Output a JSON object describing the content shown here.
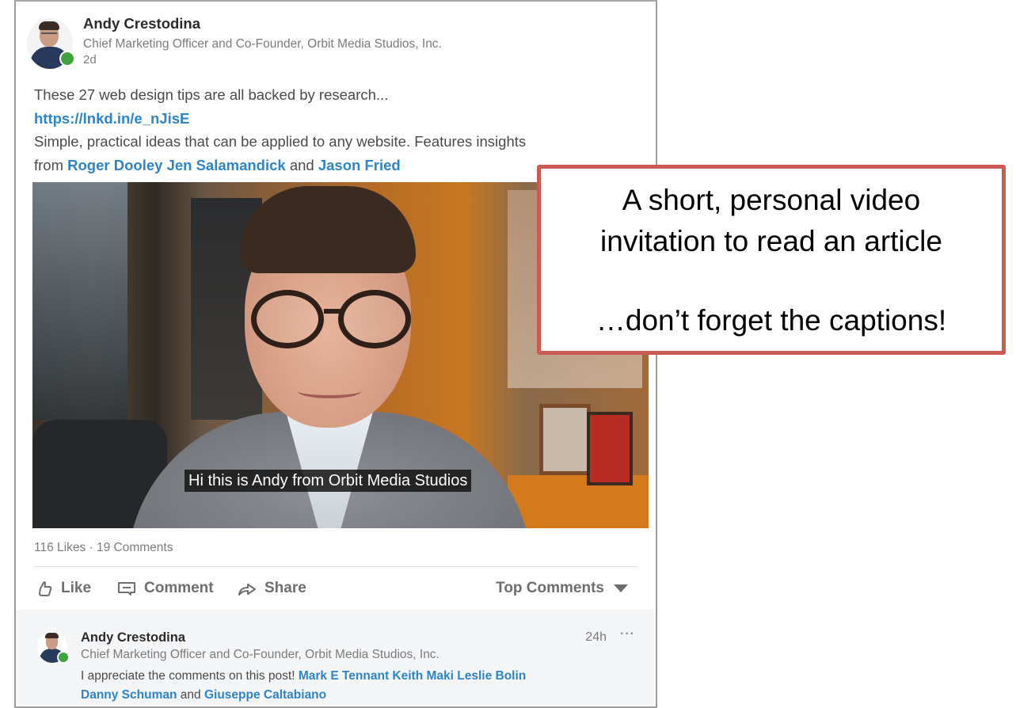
{
  "post": {
    "author": {
      "name": "Andy Crestodina",
      "title": "Chief Marketing Officer and Co-Founder, Orbit Media Studios, Inc.",
      "time": "2d",
      "status_color": "#3fa33b"
    },
    "body": {
      "line1": "These 27 web design tips are all backed by research...",
      "url": "https://lnkd.in/e_nJisE",
      "line3": "Simple, practical ideas that can be applied to any website. Features insights",
      "line4_prefix": "from ",
      "mention1": "Roger Dooley",
      "mention2": "Jen Salamandick",
      "and_text": "and",
      "mention3": "Jason Fried"
    },
    "video": {
      "caption": "Hi this is Andy from Orbit Media Studios"
    },
    "stats": {
      "likes": "116 Likes",
      "separator": "·",
      "comments": "19 Comments"
    },
    "actions": {
      "like": "Like",
      "comment": "Comment",
      "share": "Share",
      "sort": "Top Comments"
    }
  },
  "comment": {
    "author": "Andy Crestodina",
    "title": "Chief Marketing Officer and Co-Founder, Orbit Media Studios, Inc.",
    "time": "24h",
    "more": "···",
    "text_prefix": "I appreciate the comments on this post!",
    "mentions": [
      "Mark E Tennant",
      "Keith Maki",
      "Leslie Bolin",
      "Danny Schuman",
      "Giuseppe Caltabiano"
    ],
    "and_text": "and"
  },
  "callout": {
    "line1": "A short, personal video",
    "line2": "invitation to read an article",
    "line3": "…don’t forget the captions!",
    "border_color": "#cd5b55"
  },
  "colors": {
    "link": "#2f84c6",
    "muted_text": "#7b7b7b"
  }
}
